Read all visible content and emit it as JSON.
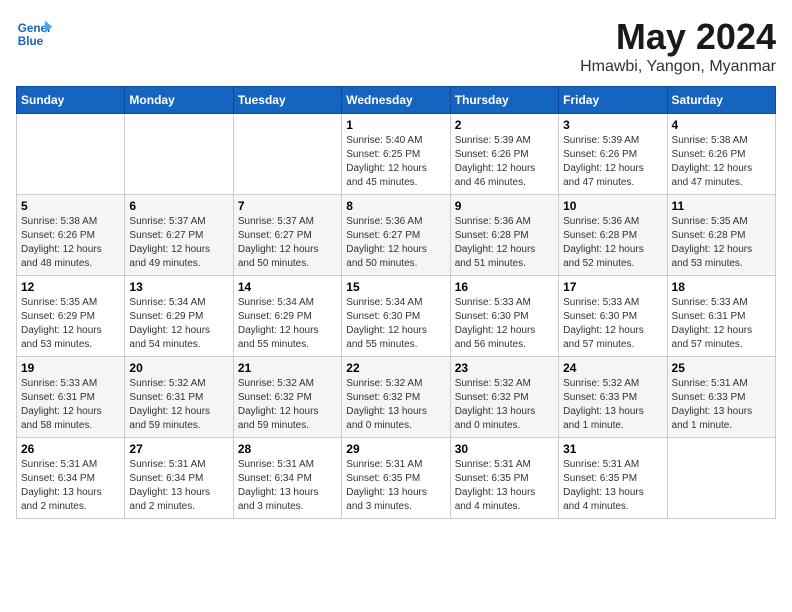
{
  "logo": {
    "line1": "General",
    "line2": "Blue"
  },
  "title": "May 2024",
  "subtitle": "Hmawbi, Yangon, Myanmar",
  "days": [
    "Sunday",
    "Monday",
    "Tuesday",
    "Wednesday",
    "Thursday",
    "Friday",
    "Saturday"
  ],
  "weeks": [
    [
      {
        "day": "",
        "info": ""
      },
      {
        "day": "",
        "info": ""
      },
      {
        "day": "",
        "info": ""
      },
      {
        "day": "1",
        "info": "Sunrise: 5:40 AM\nSunset: 6:25 PM\nDaylight: 12 hours and 45 minutes."
      },
      {
        "day": "2",
        "info": "Sunrise: 5:39 AM\nSunset: 6:26 PM\nDaylight: 12 hours and 46 minutes."
      },
      {
        "day": "3",
        "info": "Sunrise: 5:39 AM\nSunset: 6:26 PM\nDaylight: 12 hours and 47 minutes."
      },
      {
        "day": "4",
        "info": "Sunrise: 5:38 AM\nSunset: 6:26 PM\nDaylight: 12 hours and 47 minutes."
      }
    ],
    [
      {
        "day": "5",
        "info": "Sunrise: 5:38 AM\nSunset: 6:26 PM\nDaylight: 12 hours and 48 minutes."
      },
      {
        "day": "6",
        "info": "Sunrise: 5:37 AM\nSunset: 6:27 PM\nDaylight: 12 hours and 49 minutes."
      },
      {
        "day": "7",
        "info": "Sunrise: 5:37 AM\nSunset: 6:27 PM\nDaylight: 12 hours and 50 minutes."
      },
      {
        "day": "8",
        "info": "Sunrise: 5:36 AM\nSunset: 6:27 PM\nDaylight: 12 hours and 50 minutes."
      },
      {
        "day": "9",
        "info": "Sunrise: 5:36 AM\nSunset: 6:28 PM\nDaylight: 12 hours and 51 minutes."
      },
      {
        "day": "10",
        "info": "Sunrise: 5:36 AM\nSunset: 6:28 PM\nDaylight: 12 hours and 52 minutes."
      },
      {
        "day": "11",
        "info": "Sunrise: 5:35 AM\nSunset: 6:28 PM\nDaylight: 12 hours and 53 minutes."
      }
    ],
    [
      {
        "day": "12",
        "info": "Sunrise: 5:35 AM\nSunset: 6:29 PM\nDaylight: 12 hours and 53 minutes."
      },
      {
        "day": "13",
        "info": "Sunrise: 5:34 AM\nSunset: 6:29 PM\nDaylight: 12 hours and 54 minutes."
      },
      {
        "day": "14",
        "info": "Sunrise: 5:34 AM\nSunset: 6:29 PM\nDaylight: 12 hours and 55 minutes."
      },
      {
        "day": "15",
        "info": "Sunrise: 5:34 AM\nSunset: 6:30 PM\nDaylight: 12 hours and 55 minutes."
      },
      {
        "day": "16",
        "info": "Sunrise: 5:33 AM\nSunset: 6:30 PM\nDaylight: 12 hours and 56 minutes."
      },
      {
        "day": "17",
        "info": "Sunrise: 5:33 AM\nSunset: 6:30 PM\nDaylight: 12 hours and 57 minutes."
      },
      {
        "day": "18",
        "info": "Sunrise: 5:33 AM\nSunset: 6:31 PM\nDaylight: 12 hours and 57 minutes."
      }
    ],
    [
      {
        "day": "19",
        "info": "Sunrise: 5:33 AM\nSunset: 6:31 PM\nDaylight: 12 hours and 58 minutes."
      },
      {
        "day": "20",
        "info": "Sunrise: 5:32 AM\nSunset: 6:31 PM\nDaylight: 12 hours and 59 minutes."
      },
      {
        "day": "21",
        "info": "Sunrise: 5:32 AM\nSunset: 6:32 PM\nDaylight: 12 hours and 59 minutes."
      },
      {
        "day": "22",
        "info": "Sunrise: 5:32 AM\nSunset: 6:32 PM\nDaylight: 13 hours and 0 minutes."
      },
      {
        "day": "23",
        "info": "Sunrise: 5:32 AM\nSunset: 6:32 PM\nDaylight: 13 hours and 0 minutes."
      },
      {
        "day": "24",
        "info": "Sunrise: 5:32 AM\nSunset: 6:33 PM\nDaylight: 13 hours and 1 minute."
      },
      {
        "day": "25",
        "info": "Sunrise: 5:31 AM\nSunset: 6:33 PM\nDaylight: 13 hours and 1 minute."
      }
    ],
    [
      {
        "day": "26",
        "info": "Sunrise: 5:31 AM\nSunset: 6:34 PM\nDaylight: 13 hours and 2 minutes."
      },
      {
        "day": "27",
        "info": "Sunrise: 5:31 AM\nSunset: 6:34 PM\nDaylight: 13 hours and 2 minutes."
      },
      {
        "day": "28",
        "info": "Sunrise: 5:31 AM\nSunset: 6:34 PM\nDaylight: 13 hours and 3 minutes."
      },
      {
        "day": "29",
        "info": "Sunrise: 5:31 AM\nSunset: 6:35 PM\nDaylight: 13 hours and 3 minutes."
      },
      {
        "day": "30",
        "info": "Sunrise: 5:31 AM\nSunset: 6:35 PM\nDaylight: 13 hours and 4 minutes."
      },
      {
        "day": "31",
        "info": "Sunrise: 5:31 AM\nSunset: 6:35 PM\nDaylight: 13 hours and 4 minutes."
      },
      {
        "day": "",
        "info": ""
      }
    ]
  ]
}
